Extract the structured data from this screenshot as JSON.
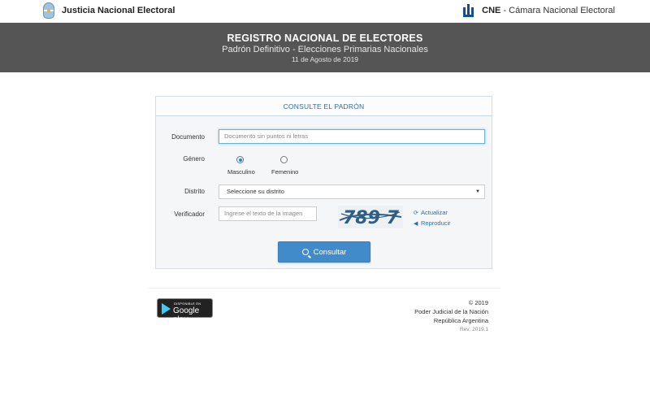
{
  "topbar": {
    "left_brand": "Justicia Nacional Electoral",
    "right_brand_bold": "CNE",
    "right_brand_rest": " - Cámara Nacional Electoral"
  },
  "header": {
    "title": "REGISTRO NACIONAL DE ELECTORES",
    "subtitle": "Padrón Definitivo - Elecciones Primarias Nacionales",
    "date": "11 de Agosto de 2019"
  },
  "form": {
    "heading": "CONSULTE EL PADRÓN",
    "documento_label": "Documento",
    "documento_placeholder": "Documento sin puntos ni letras",
    "genero_label": "Género",
    "genero_options": [
      "Masculino",
      "Femenino"
    ],
    "genero_selected": "Masculino",
    "distrito_label": "Distrito",
    "distrito_value": "Seleccione su distrito",
    "verificador_label": "Verificador",
    "verificador_placeholder": "Ingrese el texto de la imagen",
    "captcha_text": "789 7",
    "actualizar_label": "Actualizar",
    "reproducir_label": "Reproducir",
    "submit_label": "Consultar"
  },
  "footer": {
    "gplay_small": "DISPONIBLE EN",
    "gplay_big": "Google play",
    "copyright": "© 2019",
    "org": "Poder Judicial de la Nación",
    "country": "República Argentina",
    "rev": "Rev: 2019.1"
  },
  "colors": {
    "band": "#555555",
    "accent": "#428bca",
    "link": "#2e6da4"
  }
}
